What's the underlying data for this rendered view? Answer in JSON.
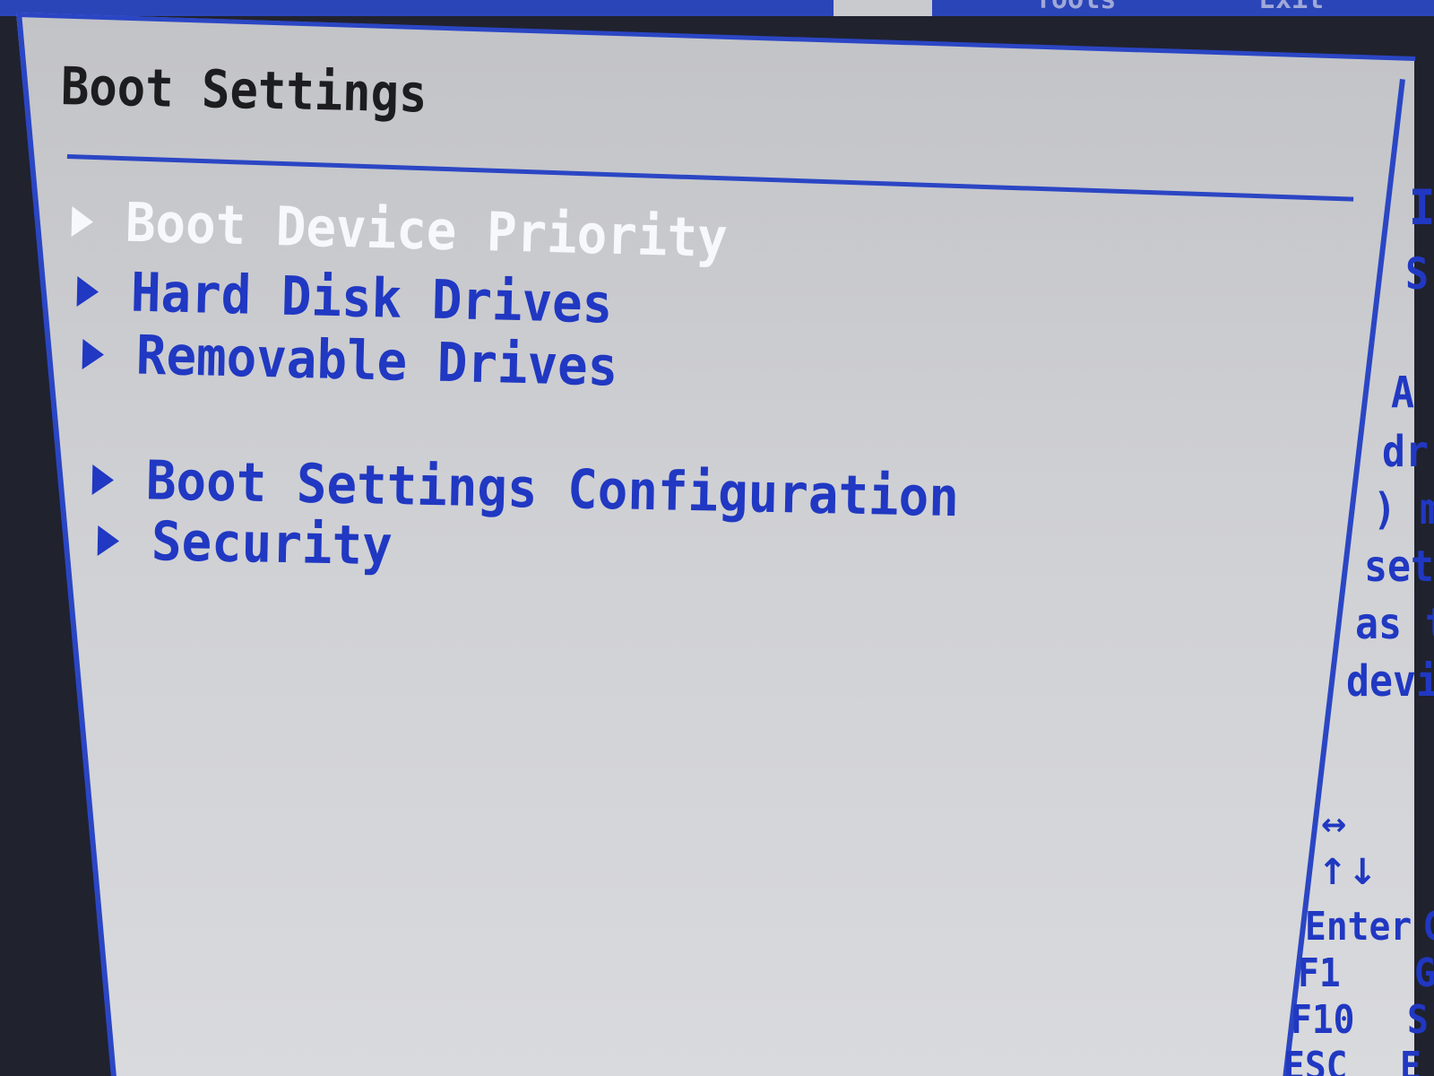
{
  "top_tabs": [
    {
      "label": "Tools"
    },
    {
      "label": "Exit"
    }
  ],
  "page": {
    "title": "Boot Settings"
  },
  "menu": [
    {
      "label": "Boot Device Priority",
      "selected": true
    },
    {
      "label": "Hard Disk Drives",
      "selected": false
    },
    {
      "label": "Removable Drives",
      "selected": false
    },
    {
      "label": "Boot Settings Configuration",
      "selected": false
    },
    {
      "label": "Security",
      "selected": false
    }
  ],
  "help_panel": {
    "lines": [
      "I",
      "S",
      "A",
      "dr",
      ") m",
      "set",
      "as t",
      "devi"
    ]
  },
  "key_legend": [
    {
      "icon": "left-right-arrows-icon",
      "key": "↔",
      "action": ""
    },
    {
      "icon": "up-down-arrows-icon",
      "key": "↑↓",
      "action": ""
    },
    {
      "key": "Enter",
      "action": "G"
    },
    {
      "key": "F1",
      "action": "G"
    },
    {
      "key": "F10",
      "action": "S"
    },
    {
      "key": "ESC",
      "action": "E"
    }
  ],
  "colors": {
    "bios_blue": "#2038c2",
    "panel_gray": "#cfd0d4",
    "selected_text": "#f7f8fb",
    "title_text": "#1d1d1f"
  }
}
